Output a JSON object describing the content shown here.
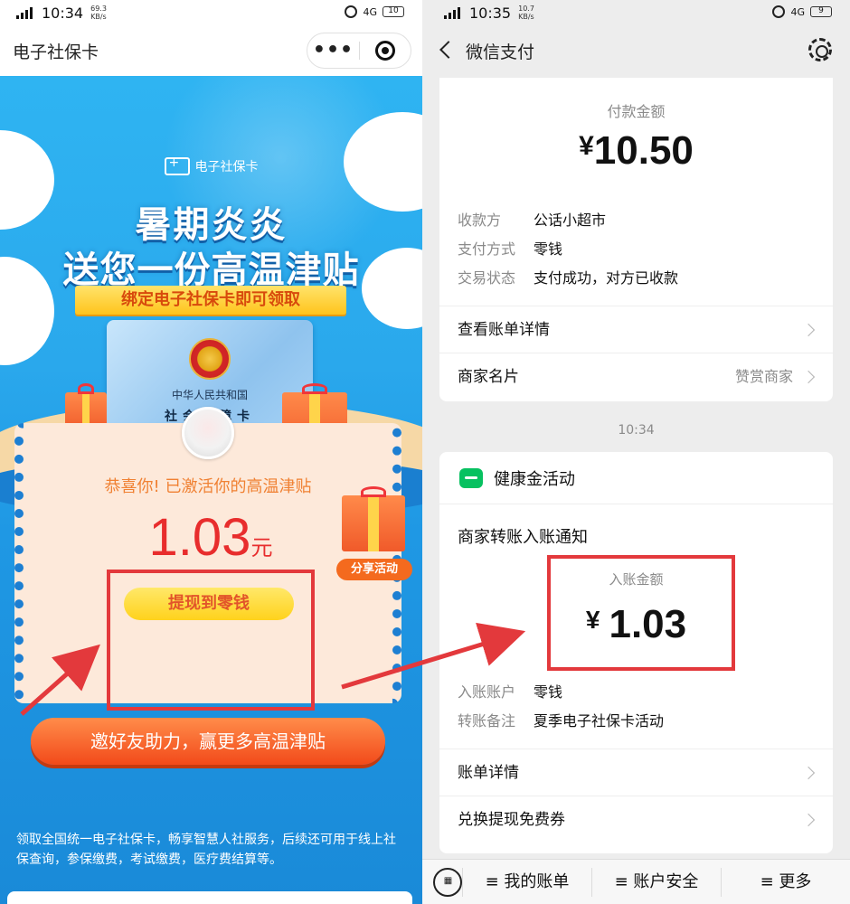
{
  "left_phone": {
    "status_bar": {
      "network": "4GHD",
      "time": "10:34",
      "speed": "69.3",
      "speed_unit": "KB/s",
      "battery": "10"
    },
    "nav": {
      "title": "电子社保卡",
      "more_icon": "ellipsis-icon",
      "close_icon": "target-icon"
    },
    "banner": {
      "brand": "电子社保卡",
      "headline_1": "暑期炎炎",
      "headline_2": "送您一份高温津贴",
      "ribbon": "绑定电子社保卡即可领取",
      "card_country": "中华人民共和国",
      "card_name": "社会保障卡"
    },
    "reward": {
      "congrats": "恭喜你! 已激活你的高温津贴",
      "amount": "1.03",
      "unit": "元",
      "withdraw_button": "提现到零钱",
      "share_label": "分享活动",
      "invite_button": "邀好友助力，赢更多高温津贴"
    },
    "description": "领取全国统一电子社保卡，畅享智慧人社服务，后续还可用于线上社保查询，参保缴费，考试缴费，医疗费结算等。"
  },
  "right_phone": {
    "status_bar": {
      "network": "4GHD",
      "time": "10:35",
      "speed": "10.7",
      "speed_unit": "KB/s",
      "battery": "9"
    },
    "nav": {
      "title": "微信支付",
      "back_icon": "chevron-left-icon",
      "settings_icon": "gear-icon"
    },
    "payment": {
      "label": "付款金额",
      "amount": "10.50",
      "currency": "¥",
      "details": [
        {
          "key": "收款方",
          "value": "公话小超市"
        },
        {
          "key": "支付方式",
          "value": "零钱"
        },
        {
          "key": "交易状态",
          "value": "支付成功，对方已收款"
        }
      ],
      "bill_detail": "查看账单详情",
      "merchant_card": "商家名片",
      "merchant_tip": "赞赏商家"
    },
    "separator_time": "10:34",
    "transfer": {
      "header": "健康金活动",
      "title": "商家转账入账通知",
      "label": "入账金额",
      "currency": "¥",
      "amount": "1.03",
      "details": [
        {
          "key": "入账账户",
          "value": "零钱"
        },
        {
          "key": "转账备注",
          "value": "夏季电子社保卡活动"
        }
      ],
      "bill_detail": "账单详情",
      "coupon": "兑换提现免费券"
    },
    "bottom_bar": {
      "keyboard_icon": "keyboard-icon",
      "items": [
        "≡ 我的账单",
        "≡ 账户安全",
        "≡ 更多"
      ]
    }
  },
  "colors": {
    "highlight_red": "#e3393c",
    "wechat_green": "#07c160",
    "reward_red": "#e82d2d"
  }
}
